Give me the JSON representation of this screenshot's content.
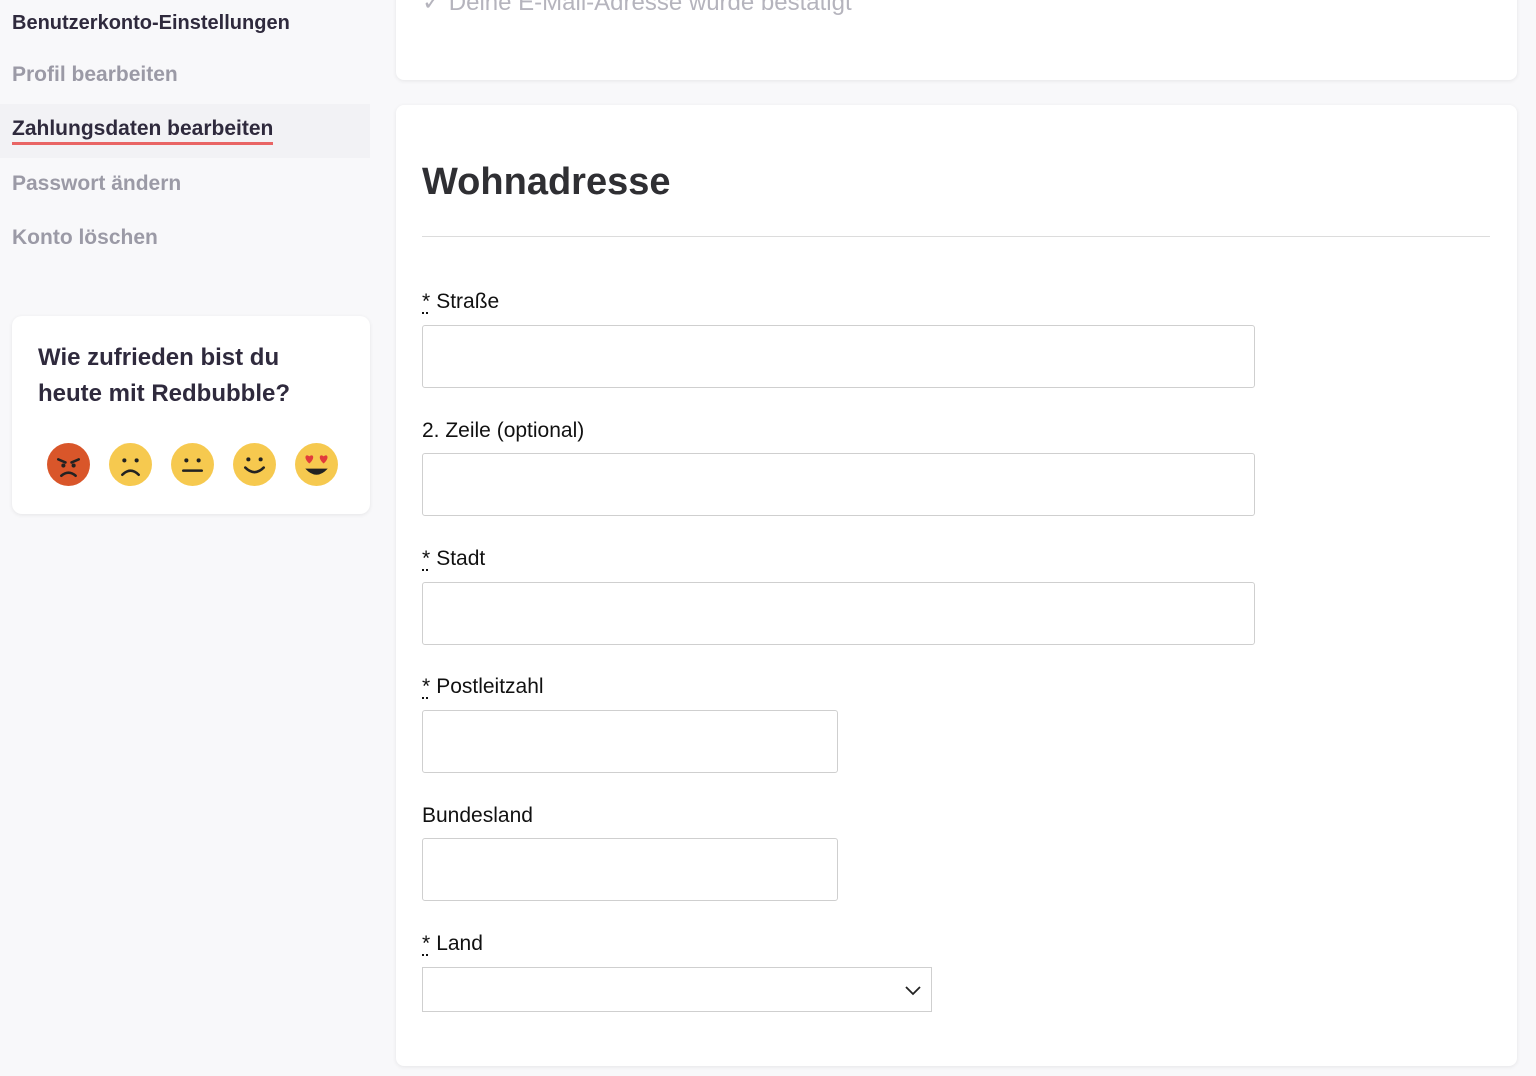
{
  "sidebar": {
    "heading": "Benutzerkonto-Einstellungen",
    "items": [
      {
        "label": "Profil bearbeiten",
        "active": false
      },
      {
        "label": "Zahlungsdaten bearbeiten",
        "active": true
      },
      {
        "label": "Passwort ändern",
        "active": false
      },
      {
        "label": "Konto löschen",
        "active": false
      }
    ],
    "accent_color": "#e96565"
  },
  "survey": {
    "title": "Wie zufrieden bist du heute mit Redbubble?",
    "emojis": [
      "angry-face-icon",
      "frowning-face-icon",
      "neutral-face-icon",
      "slightly-smiling-face-icon",
      "heart-eyes-face-icon"
    ]
  },
  "verification": {
    "text": "✓ Deine E-Mail-Adresse wurde bestätigt"
  },
  "address": {
    "title": "Wohnadresse",
    "required_marker": "*",
    "fields": {
      "street": {
        "label": "Straße",
        "value": ""
      },
      "line2": {
        "label": "2. Zeile (optional)",
        "value": ""
      },
      "city": {
        "label": "Stadt",
        "value": ""
      },
      "postcode": {
        "label": "Postleitzahl",
        "value": ""
      },
      "state": {
        "label": "Bundesland",
        "value": ""
      },
      "country": {
        "label": "Land",
        "value": ""
      }
    }
  }
}
